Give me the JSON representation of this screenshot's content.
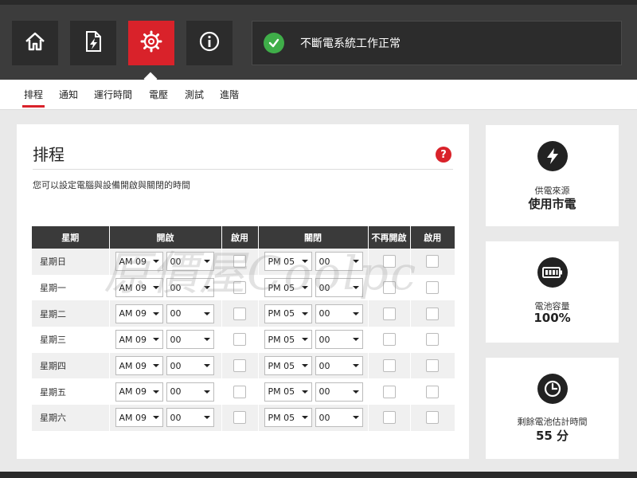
{
  "nav": {
    "buttons": [
      {
        "name": "home",
        "icon": "home-icon"
      },
      {
        "name": "power-file",
        "icon": "power-file-icon"
      },
      {
        "name": "settings",
        "icon": "gear-icon",
        "active": true
      },
      {
        "name": "info",
        "icon": "info-icon"
      }
    ]
  },
  "status": {
    "text": "不斷電系統工作正常",
    "icon": "check-icon",
    "icon_color": "#3fae49"
  },
  "subnav": {
    "tabs": [
      {
        "label": "排程",
        "active": true
      },
      {
        "label": "通知"
      },
      {
        "label": "運行時間"
      },
      {
        "label": "電壓"
      },
      {
        "label": "測試"
      },
      {
        "label": "進階"
      }
    ]
  },
  "schedule": {
    "title": "排程",
    "help_icon": "?",
    "description": "您可以設定電腦與設備開啟與關閉的時間",
    "headers": {
      "day": "星期",
      "open": "開啟",
      "enable1": "啟用",
      "close": "關閉",
      "no_reopen": "不再開啟",
      "enable2": "啟用"
    },
    "rows": [
      {
        "day": "星期日",
        "open_ampm": "AM 09",
        "open_min": "00",
        "close_ampm": "PM 05",
        "close_min": "00"
      },
      {
        "day": "星期一",
        "open_ampm": "AM 09",
        "open_min": "00",
        "close_ampm": "PM 05",
        "close_min": "00"
      },
      {
        "day": "星期二",
        "open_ampm": "AM 09",
        "open_min": "00",
        "close_ampm": "PM 05",
        "close_min": "00"
      },
      {
        "day": "星期三",
        "open_ampm": "AM 09",
        "open_min": "00",
        "close_ampm": "PM 05",
        "close_min": "00"
      },
      {
        "day": "星期四",
        "open_ampm": "AM 09",
        "open_min": "00",
        "close_ampm": "PM 05",
        "close_min": "00"
      },
      {
        "day": "星期五",
        "open_ampm": "AM 09",
        "open_min": "00",
        "close_ampm": "PM 05",
        "close_min": "00"
      },
      {
        "day": "星期六",
        "open_ampm": "AM 09",
        "open_min": "00",
        "close_ampm": "PM 05",
        "close_min": "00"
      }
    ]
  },
  "cards": {
    "power_source": {
      "label": "供電來源",
      "value": "使用市電",
      "icon": "lightning-icon"
    },
    "battery": {
      "label": "電池容量",
      "value": "100%",
      "icon": "battery-icon"
    },
    "runtime": {
      "label": "剩餘電池估計時間",
      "value": "55 分",
      "icon": "clock-icon"
    }
  },
  "watermark": {
    "text": "原價屋Coolpc"
  },
  "colors": {
    "accent": "#d9222a",
    "topbar": "#3c3c3c",
    "ok": "#3fae49"
  }
}
